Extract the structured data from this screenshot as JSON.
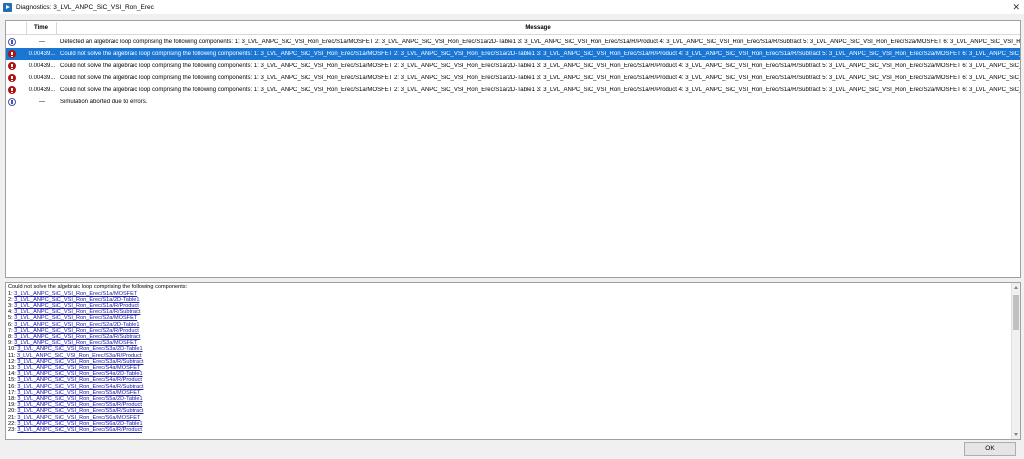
{
  "window": {
    "title": "Diagnostics: 3_LVL_ANPC_SiC_VSI_Ron_Erec",
    "close_glyph": "✕"
  },
  "table": {
    "headers": {
      "time": "Time",
      "message": "Message"
    },
    "rows": [
      {
        "type": "info",
        "icon": "info-icon",
        "time": "—",
        "message": "Detected an algebraic loop comprising the following components: 1: 3_LVL_ANPC_SiC_VSI_Ron_Erec/S1a/MOSFET 2: 3_LVL_ANPC_SiC_VSI_Ron_Erec/S1a/2D-Table1 3: 3_LVL_ANPC_SiC_VSI_Ron_Erec/S1a/R/Product 4: 3_LVL_ANPC_SiC_VSI_Ron_Erec/S1a/R/Subtract 5: 3_LVL_ANPC_SiC_VSI_Ron_Erec/S2a/MOSFET 6: 3_LVL_ANPC_SiC_VSI_Ron_Erec/S2a/2D-Table1 7: 3_LVL_ANPC_SiC_VSI_Ron_Erec/S2a/R/Product",
        "selected": false
      },
      {
        "type": "error",
        "icon": "error-icon",
        "time": "0.00439...",
        "message": "Could not solve the algebraic loop comprising the following components: 1: 3_LVL_ANPC_SiC_VSI_Ron_Erec/S1a/MOSFET 2: 3_LVL_ANPC_SiC_VSI_Ron_Erec/S1a/2D-Table1 3: 3_LVL_ANPC_SiC_VSI_Ron_Erec/S1a/R/Product 4: 3_LVL_ANPC_SiC_VSI_Ron_Erec/S1a/R/Subtract 5: 3_LVL_ANPC_SiC_VSI_Ron_Erec/S2a/MOSFET 6: 3_LVL_ANPC_SiC_VSI_Ron_Erec/S2a/2D-Table1",
        "selected": true
      },
      {
        "type": "error",
        "icon": "error-icon",
        "time": "0.00439...",
        "message": "Could not solve the algebraic loop comprising the following components: 1: 3_LVL_ANPC_SiC_VSI_Ron_Erec/S1a/MOSFET 2: 3_LVL_ANPC_SiC_VSI_Ron_Erec/S1a/2D-Table1 3: 3_LVL_ANPC_SiC_VSI_Ron_Erec/S1a/R/Product 4: 3_LVL_ANPC_SiC_VSI_Ron_Erec/S1a/R/Subtract 5: 3_LVL_ANPC_SiC_VSI_Ron_Erec/S2a/MOSFET 6: 3_LVL_ANPC_SiC_VSI_Ron_Erec/S2a/2D-Table1",
        "selected": false
      },
      {
        "type": "error",
        "icon": "error-icon",
        "time": "0.00439...",
        "message": "Could not solve the algebraic loop comprising the following components: 1: 3_LVL_ANPC_SiC_VSI_Ron_Erec/S1a/MOSFET 2: 3_LVL_ANPC_SiC_VSI_Ron_Erec/S1a/2D-Table1 3: 3_LVL_ANPC_SiC_VSI_Ron_Erec/S1a/R/Product 4: 3_LVL_ANPC_SiC_VSI_Ron_Erec/S1a/R/Subtract 5: 3_LVL_ANPC_SiC_VSI_Ron_Erec/S2a/MOSFET 6: 3_LVL_ANPC_SiC_VSI_Ron_Erec/S2a/2D-Table1",
        "selected": false
      },
      {
        "type": "error",
        "icon": "error-icon",
        "time": "0.00439...",
        "message": "Could not solve the algebraic loop comprising the following components: 1: 3_LVL_ANPC_SiC_VSI_Ron_Erec/S1a/MOSFET 2: 3_LVL_ANPC_SiC_VSI_Ron_Erec/S1a/2D-Table1 3: 3_LVL_ANPC_SiC_VSI_Ron_Erec/S1a/R/Product 4: 3_LVL_ANPC_SiC_VSI_Ron_Erec/S1a/R/Subtract 5: 3_LVL_ANPC_SiC_VSI_Ron_Erec/S2a/MOSFET 6: 3_LVL_ANPC_SiC_VSI_Ron_Erec/S2a/2D-Table1",
        "selected": false
      },
      {
        "type": "info",
        "icon": "info-icon",
        "time": "—",
        "message": "Simulation aborted due to errors.",
        "selected": false
      }
    ]
  },
  "detail": {
    "header": "Could not solve the algebraic loop comprising the following components:",
    "items": [
      {
        "num": "1:",
        "path": "3_LVL_ANPC_SiC_VSI_Ron_Erec/S1a/MOSFET"
      },
      {
        "num": "2:",
        "path": "3_LVL_ANPC_SiC_VSI_Ron_Erec/S1a/2D-Table1"
      },
      {
        "num": "3:",
        "path": "3_LVL_ANPC_SiC_VSI_Ron_Erec/S1a/R/Product"
      },
      {
        "num": "4:",
        "path": "3_LVL_ANPC_SiC_VSI_Ron_Erec/S1a/R/Subtract"
      },
      {
        "num": "5:",
        "path": "3_LVL_ANPC_SiC_VSI_Ron_Erec/S2a/MOSFET"
      },
      {
        "num": "6:",
        "path": "3_LVL_ANPC_SiC_VSI_Ron_Erec/S2a/2D-Table1"
      },
      {
        "num": "7:",
        "path": "3_LVL_ANPC_SiC_VSI_Ron_Erec/S2a/R/Product"
      },
      {
        "num": "8:",
        "path": "3_LVL_ANPC_SiC_VSI_Ron_Erec/S2a/R/Subtract"
      },
      {
        "num": "9:",
        "path": "3_LVL_ANPC_SiC_VSI_Ron_Erec/S3a/MOSFET"
      },
      {
        "num": "10:",
        "path": "3_LVL_ANPC_SiC_VSI_Ron_Erec/S3a/2D-Table1"
      },
      {
        "num": "11:",
        "path": "3_LVL_ANPC_SiC_VSI_Ron_Erec/S3a/R/Product"
      },
      {
        "num": "12:",
        "path": "3_LVL_ANPC_SiC_VSI_Ron_Erec/S3a/R/Subtract"
      },
      {
        "num": "13:",
        "path": "3_LVL_ANPC_SiC_VSI_Ron_Erec/S4a/MOSFET"
      },
      {
        "num": "14:",
        "path": "3_LVL_ANPC_SiC_VSI_Ron_Erec/S4a/2D-Table1"
      },
      {
        "num": "15:",
        "path": "3_LVL_ANPC_SiC_VSI_Ron_Erec/S4a/R/Product"
      },
      {
        "num": "16:",
        "path": "3_LVL_ANPC_SiC_VSI_Ron_Erec/S4a/R/Subtract"
      },
      {
        "num": "17:",
        "path": "3_LVL_ANPC_SiC_VSI_Ron_Erec/S5a/MOSFET"
      },
      {
        "num": "18:",
        "path": "3_LVL_ANPC_SiC_VSI_Ron_Erec/S5a/2D-Table1"
      },
      {
        "num": "19:",
        "path": "3_LVL_ANPC_SiC_VSI_Ron_Erec/S5a/R/Product"
      },
      {
        "num": "20:",
        "path": "3_LVL_ANPC_SiC_VSI_Ron_Erec/S5a/R/Subtract"
      },
      {
        "num": "21:",
        "path": "3_LVL_ANPC_SiC_VSI_Ron_Erec/S6a/MOSFET"
      },
      {
        "num": "22:",
        "path": "3_LVL_ANPC_SiC_VSI_Ron_Erec/S6a/2D-Table1"
      },
      {
        "num": "23:",
        "path": "3_LVL_ANPC_SiC_VSI_Ron_Erec/S6a/R/Product"
      }
    ]
  },
  "footer": {
    "ok_label": "OK"
  }
}
